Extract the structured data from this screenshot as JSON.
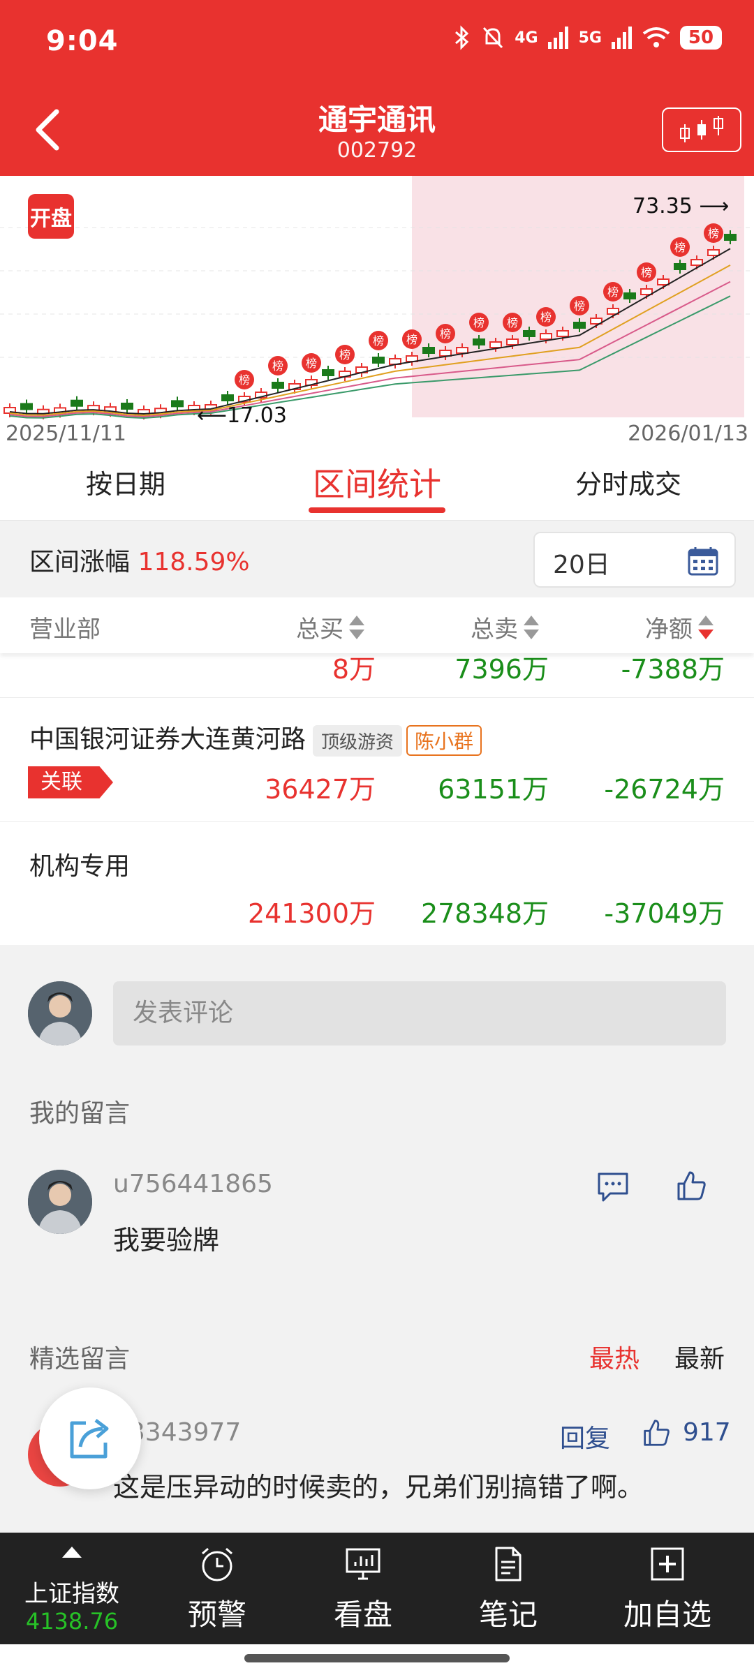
{
  "status_bar": {
    "time": "9:04",
    "battery": "50",
    "net1": "4G",
    "net2": "5G"
  },
  "header": {
    "title": "通宇通讯",
    "code": "002792"
  },
  "chart": {
    "badge": "开盘",
    "date_start": "2025/11/11",
    "date_end": "2026/01/13",
    "high_label": "73.35",
    "low_label": "17.03",
    "marker_text": "榜"
  },
  "tabs": [
    "按日期",
    "区间统计",
    "分时成交"
  ],
  "range": {
    "label": "区间涨幅",
    "value": "118.59%",
    "select_value": "20日"
  },
  "table": {
    "headers": {
      "dept": "营业部",
      "buy": "总买",
      "sell": "总卖",
      "net": "净额"
    },
    "partial_row": {
      "buy": "8万",
      "sell": "7396万",
      "net": "-7388万"
    },
    "rows": [
      {
        "name": "中国银河证券大连黄河路",
        "tag1": "顶级游资",
        "tag2": "陈小群",
        "assoc": "关联",
        "buy": "36427万",
        "sell": "63151万",
        "net": "-26724万"
      },
      {
        "name": "机构专用",
        "buy": "241300万",
        "sell": "278348万",
        "net": "-37049万"
      }
    ]
  },
  "comments": {
    "input_placeholder": "发表评论",
    "my_title": "我的留言",
    "my_comment": {
      "user": "u756441865",
      "text": "我要验牌"
    },
    "selected_title": "精选留言",
    "sort_hot": "最热",
    "sort_new": "最新",
    "featured": {
      "user": "13343977",
      "reply": "回复",
      "likes": "917",
      "text": "这是压异动的时候卖的，兄弟们别搞错了啊。"
    }
  },
  "bottom_nav": {
    "index_name": "上证指数",
    "index_value": "4138.76",
    "items": [
      "预警",
      "看盘",
      "笔记",
      "加自选"
    ]
  },
  "colors": {
    "brand_red": "#e8322f",
    "up_red": "#e8322f",
    "down_green": "#1a8e1a"
  }
}
